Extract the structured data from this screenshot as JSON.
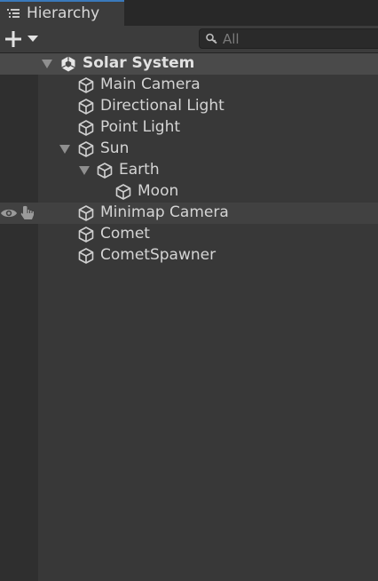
{
  "window": {
    "tab_label": "Hierarchy",
    "tab_icon": "list-icon"
  },
  "toolbar": {
    "add_icon": "plus-icon",
    "add_menu_icon": "caret-down-icon",
    "search": {
      "placeholder": "All",
      "value": "",
      "icon": "search-icon"
    }
  },
  "hierarchy": {
    "scene": {
      "name": "Solar System",
      "icon": "unity-scene-icon",
      "expanded": true
    },
    "items": [
      {
        "name": "Main Camera",
        "depth": 1,
        "icon": "gameobject-cube-icon",
        "has_children": false
      },
      {
        "name": "Directional Light",
        "depth": 1,
        "icon": "gameobject-cube-icon",
        "has_children": false
      },
      {
        "name": "Point Light",
        "depth": 1,
        "icon": "gameobject-cube-icon",
        "has_children": false
      },
      {
        "name": "Sun",
        "depth": 1,
        "icon": "gameobject-cube-icon",
        "has_children": true,
        "expanded": true
      },
      {
        "name": "Earth",
        "depth": 2,
        "icon": "gameobject-cube-icon",
        "has_children": true,
        "expanded": true
      },
      {
        "name": "Moon",
        "depth": 3,
        "icon": "gameobject-cube-icon",
        "has_children": false
      },
      {
        "name": "Minimap Camera",
        "depth": 1,
        "icon": "gameobject-cube-icon",
        "has_children": false,
        "hovered": true,
        "gutter_icons": [
          "eye-icon",
          "hand-pickable-icon"
        ]
      },
      {
        "name": "Comet",
        "depth": 1,
        "icon": "gameobject-cube-icon",
        "has_children": false
      },
      {
        "name": "CometSpawner",
        "depth": 1,
        "icon": "gameobject-cube-icon",
        "has_children": false
      }
    ]
  },
  "colors": {
    "panel_bg": "#383838",
    "gutter_bg": "#2f2f2f",
    "scene_row_bg": "#4a4a4a",
    "hover_row_bg": "#414141",
    "tab_accent": "#3a79bb",
    "text": "#d4d4d4"
  }
}
